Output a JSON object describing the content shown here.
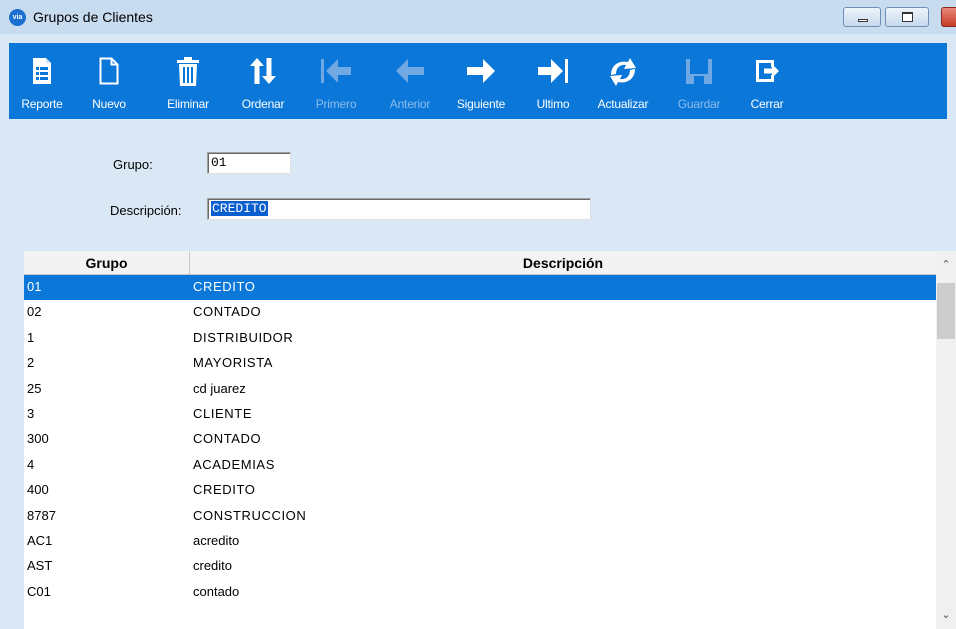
{
  "window": {
    "title": "Grupos de Clientes",
    "app_icon_text": "via"
  },
  "toolbar": {
    "buttons": [
      {
        "label": "Reporte",
        "icon": "report-icon",
        "enabled": true
      },
      {
        "label": "Nuevo",
        "icon": "new-document-icon",
        "enabled": true
      },
      {
        "label": "Eliminar",
        "icon": "trash-icon",
        "enabled": true
      },
      {
        "label": "Ordenar",
        "icon": "sort-arrows-icon",
        "enabled": true
      },
      {
        "label": "Primero",
        "icon": "first-record-icon",
        "enabled": false
      },
      {
        "label": "Anterior",
        "icon": "previous-arrow-icon",
        "enabled": false
      },
      {
        "label": "Siguiente",
        "icon": "next-arrow-icon",
        "enabled": true
      },
      {
        "label": "Ultimo",
        "icon": "last-record-icon",
        "enabled": true
      },
      {
        "label": "Actualizar",
        "icon": "refresh-icon",
        "enabled": true
      },
      {
        "label": "Guardar",
        "icon": "save-icon",
        "enabled": false
      },
      {
        "label": "Cerrar",
        "icon": "exit-icon",
        "enabled": true
      }
    ]
  },
  "form": {
    "grupo_label": "Grupo:",
    "grupo_value": "01",
    "descripcion_label": "Descripción:",
    "descripcion_value": "CREDITO"
  },
  "grid": {
    "columns": [
      "Grupo",
      "Descripción"
    ],
    "rows": [
      {
        "grupo": "01",
        "descripcion": "CREDITO",
        "selected": true
      },
      {
        "grupo": "02",
        "descripcion": "CONTADO"
      },
      {
        "grupo": "1",
        "descripcion": "DISTRIBUIDOR"
      },
      {
        "grupo": "2",
        "descripcion": "MAYORISTA"
      },
      {
        "grupo": "25",
        "descripcion": "cd juarez"
      },
      {
        "grupo": "3",
        "descripcion": "CLIENTE"
      },
      {
        "grupo": "300",
        "descripcion": "CONTADO"
      },
      {
        "grupo": "4",
        "descripcion": "ACADEMIAS"
      },
      {
        "grupo": "400",
        "descripcion": "CREDITO"
      },
      {
        "grupo": "8787",
        "descripcion": "CONSTRUCCION"
      },
      {
        "grupo": "AC1",
        "descripcion": "acredito"
      },
      {
        "grupo": "AST",
        "descripcion": "credito"
      },
      {
        "grupo": "C01",
        "descripcion": "contado"
      }
    ]
  },
  "colors": {
    "toolbar_bg": "#0a77d9",
    "panel_bg": "#dae8f5",
    "selection": "#0a77d9",
    "disabled_label": "#8fbdeb"
  }
}
